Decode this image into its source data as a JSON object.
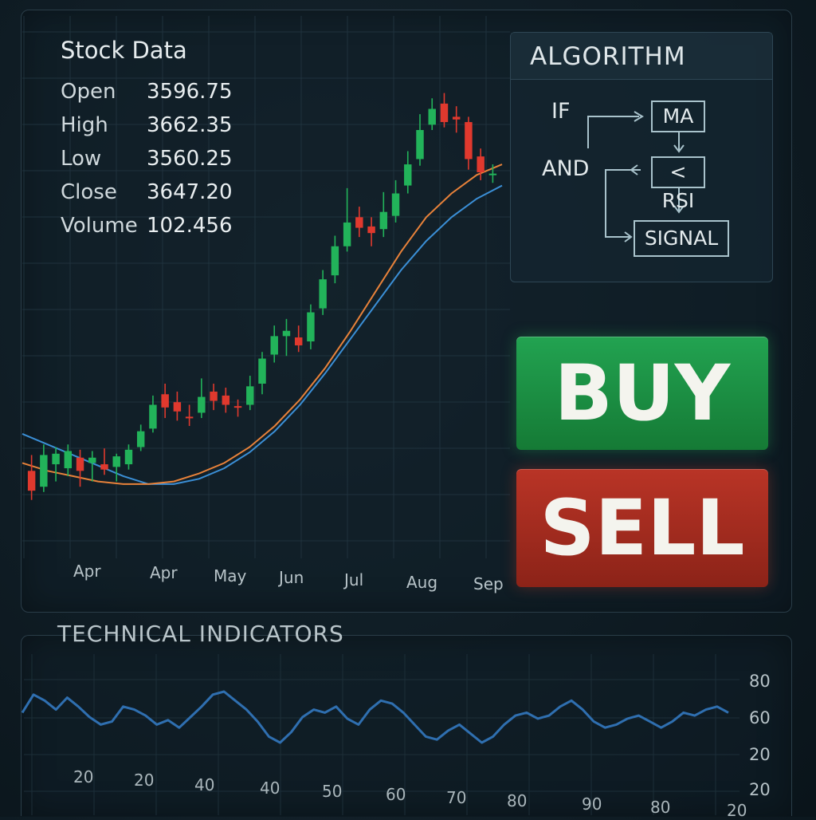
{
  "stock": {
    "title": "Stock Data",
    "rows": [
      {
        "label": "Open",
        "value": "3596.75"
      },
      {
        "label": "High",
        "value": "3662.35"
      },
      {
        "label": "Low",
        "value": "3560.25"
      },
      {
        "label": "Close",
        "value": "3647.20"
      },
      {
        "label": "Volume",
        "value": "102.456"
      }
    ]
  },
  "algorithm": {
    "title": "ALGORITHM",
    "if_label": "IF",
    "and_label": "AND",
    "nodes": {
      "ma": "MA",
      "rsi": "< RSI",
      "signal": "SIGNAL"
    }
  },
  "actions": {
    "buy": "BUY",
    "sell": "SELL"
  },
  "colors": {
    "up": "#22b35a",
    "down": "#e0392e",
    "ma_fast": "#e8823a",
    "ma_slow": "#3b8fd6",
    "rsi": "#2f6fb0"
  },
  "chart_data": [
    {
      "type": "candlestick",
      "x_ticks": [
        "Apr",
        "Apr",
        "May",
        "Jun",
        "Jul",
        "Aug",
        "Sep"
      ],
      "candles": [
        {
          "o": 3440,
          "c": 3425,
          "h": 3452,
          "l": 3418
        },
        {
          "o": 3428,
          "c": 3452,
          "h": 3460,
          "l": 3424
        },
        {
          "o": 3445,
          "c": 3453,
          "h": 3458,
          "l": 3432
        },
        {
          "o": 3442,
          "c": 3455,
          "h": 3460,
          "l": 3436
        },
        {
          "o": 3450,
          "c": 3440,
          "h": 3456,
          "l": 3428
        },
        {
          "o": 3446,
          "c": 3450,
          "h": 3455,
          "l": 3432
        },
        {
          "o": 3445,
          "c": 3441,
          "h": 3457,
          "l": 3437
        },
        {
          "o": 3443,
          "c": 3451,
          "h": 3453,
          "l": 3432
        },
        {
          "o": 3445,
          "c": 3456,
          "h": 3460,
          "l": 3441
        },
        {
          "o": 3458,
          "c": 3470,
          "h": 3475,
          "l": 3455
        },
        {
          "o": 3472,
          "c": 3490,
          "h": 3497,
          "l": 3469
        },
        {
          "o": 3498,
          "c": 3488,
          "h": 3506,
          "l": 3480
        },
        {
          "o": 3492,
          "c": 3485,
          "h": 3500,
          "l": 3478
        },
        {
          "o": 3481,
          "c": 3480,
          "h": 3490,
          "l": 3474
        },
        {
          "o": 3484,
          "c": 3496,
          "h": 3510,
          "l": 3480
        },
        {
          "o": 3500,
          "c": 3493,
          "h": 3506,
          "l": 3486
        },
        {
          "o": 3497,
          "c": 3490,
          "h": 3503,
          "l": 3484
        },
        {
          "o": 3489,
          "c": 3488,
          "h": 3494,
          "l": 3481
        },
        {
          "o": 3490,
          "c": 3504,
          "h": 3512,
          "l": 3486
        },
        {
          "o": 3506,
          "c": 3525,
          "h": 3530,
          "l": 3498
        },
        {
          "o": 3528,
          "c": 3542,
          "h": 3550,
          "l": 3522
        },
        {
          "o": 3542,
          "c": 3546,
          "h": 3555,
          "l": 3527
        },
        {
          "o": 3541,
          "c": 3535,
          "h": 3550,
          "l": 3530
        },
        {
          "o": 3538,
          "c": 3560,
          "h": 3566,
          "l": 3532
        },
        {
          "o": 3563,
          "c": 3585,
          "h": 3592,
          "l": 3558
        },
        {
          "o": 3588,
          "c": 3610,
          "h": 3618,
          "l": 3582
        },
        {
          "o": 3610,
          "c": 3628,
          "h": 3654,
          "l": 3606
        },
        {
          "o": 3632,
          "c": 3624,
          "h": 3640,
          "l": 3617
        },
        {
          "o": 3625,
          "c": 3620,
          "h": 3632,
          "l": 3610
        },
        {
          "o": 3623,
          "c": 3636,
          "h": 3651,
          "l": 3617
        },
        {
          "o": 3633,
          "c": 3650,
          "h": 3660,
          "l": 3628
        },
        {
          "o": 3656,
          "c": 3672,
          "h": 3682,
          "l": 3650
        },
        {
          "o": 3676,
          "c": 3698,
          "h": 3710,
          "l": 3671
        },
        {
          "o": 3702,
          "c": 3714,
          "h": 3722,
          "l": 3698
        },
        {
          "o": 3718,
          "c": 3704,
          "h": 3726,
          "l": 3700
        },
        {
          "o": 3708,
          "c": 3706,
          "h": 3716,
          "l": 3696
        },
        {
          "o": 3704,
          "c": 3676,
          "h": 3708,
          "l": 3668
        },
        {
          "o": 3678,
          "c": 3666,
          "h": 3684,
          "l": 3660
        },
        {
          "o": 3664,
          "c": 3665,
          "h": 3672,
          "l": 3658
        }
      ],
      "ma_fast": [
        3446,
        3440,
        3436,
        3432,
        3430,
        3430,
        3432,
        3438,
        3446,
        3458,
        3474,
        3494,
        3518,
        3546,
        3576,
        3606,
        3632,
        3650,
        3664,
        3672
      ],
      "ma_slow": [
        3468,
        3460,
        3452,
        3444,
        3436,
        3430,
        3430,
        3434,
        3442,
        3454,
        3470,
        3490,
        3514,
        3540,
        3566,
        3592,
        3614,
        3632,
        3646,
        3656
      ]
    },
    {
      "type": "line",
      "title": "TECHNICAL INDICATORS",
      "y_ticks": [
        "80",
        "60",
        "20",
        "20"
      ],
      "x_ticks": [
        "20",
        "20",
        "40",
        "40",
        "50",
        "60",
        "70",
        "80",
        "90",
        "80",
        "20"
      ],
      "values": [
        58,
        70,
        66,
        60,
        68,
        62,
        55,
        50,
        52,
        62,
        60,
        56,
        50,
        53,
        48,
        55,
        62,
        70,
        72,
        66,
        60,
        52,
        42,
        38,
        45,
        55,
        60,
        58,
        62,
        54,
        50,
        60,
        66,
        64,
        58,
        50,
        42,
        40,
        46,
        50,
        44,
        38,
        42,
        50,
        56,
        58,
        54,
        56,
        62,
        66,
        60,
        52,
        48,
        50,
        54,
        56,
        52,
        48,
        52,
        58,
        56,
        60,
        62,
        58
      ]
    }
  ]
}
